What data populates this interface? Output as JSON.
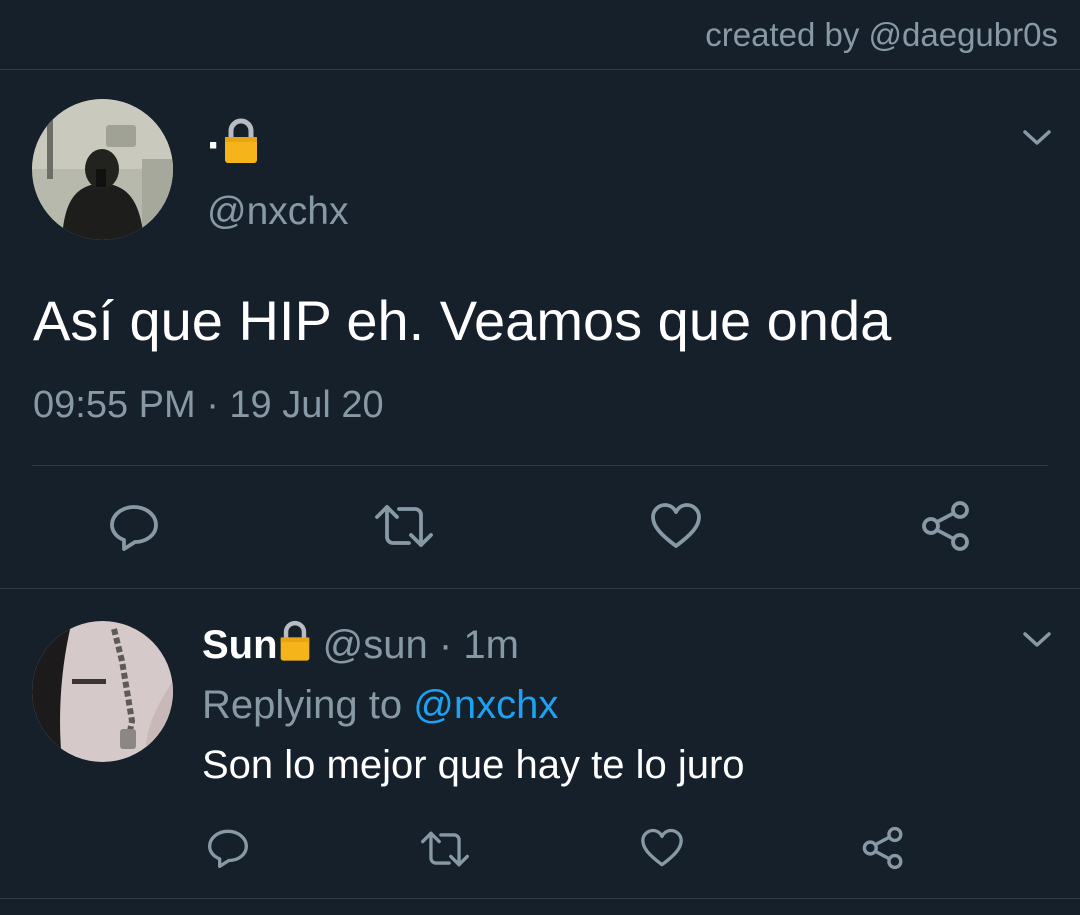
{
  "credit": "created by @daegubr0s",
  "tweet": {
    "display_name": "·",
    "handle": "@nxchx",
    "text": "Así que HIP eh. Veamos que onda",
    "timestamp": "09:55 PM · 19 Jul 20",
    "actions": [
      "reply-icon",
      "retweet-icon",
      "like-icon",
      "share-icon"
    ]
  },
  "reply": {
    "display_name": "Sun",
    "handle": "@sun",
    "separator": " · ",
    "time": "1m",
    "replying_prefix": "Replying to ",
    "replying_to": "@nxchx",
    "text": "Son lo mejor que hay te lo juro",
    "actions": [
      "reply-icon",
      "retweet-icon",
      "like-icon",
      "share-icon"
    ]
  },
  "colors": {
    "background": "#15202b",
    "secondary_text": "#8899a6",
    "link": "#1da1f2",
    "divider": "#2f3d4a",
    "lock": "#f5b51a"
  }
}
